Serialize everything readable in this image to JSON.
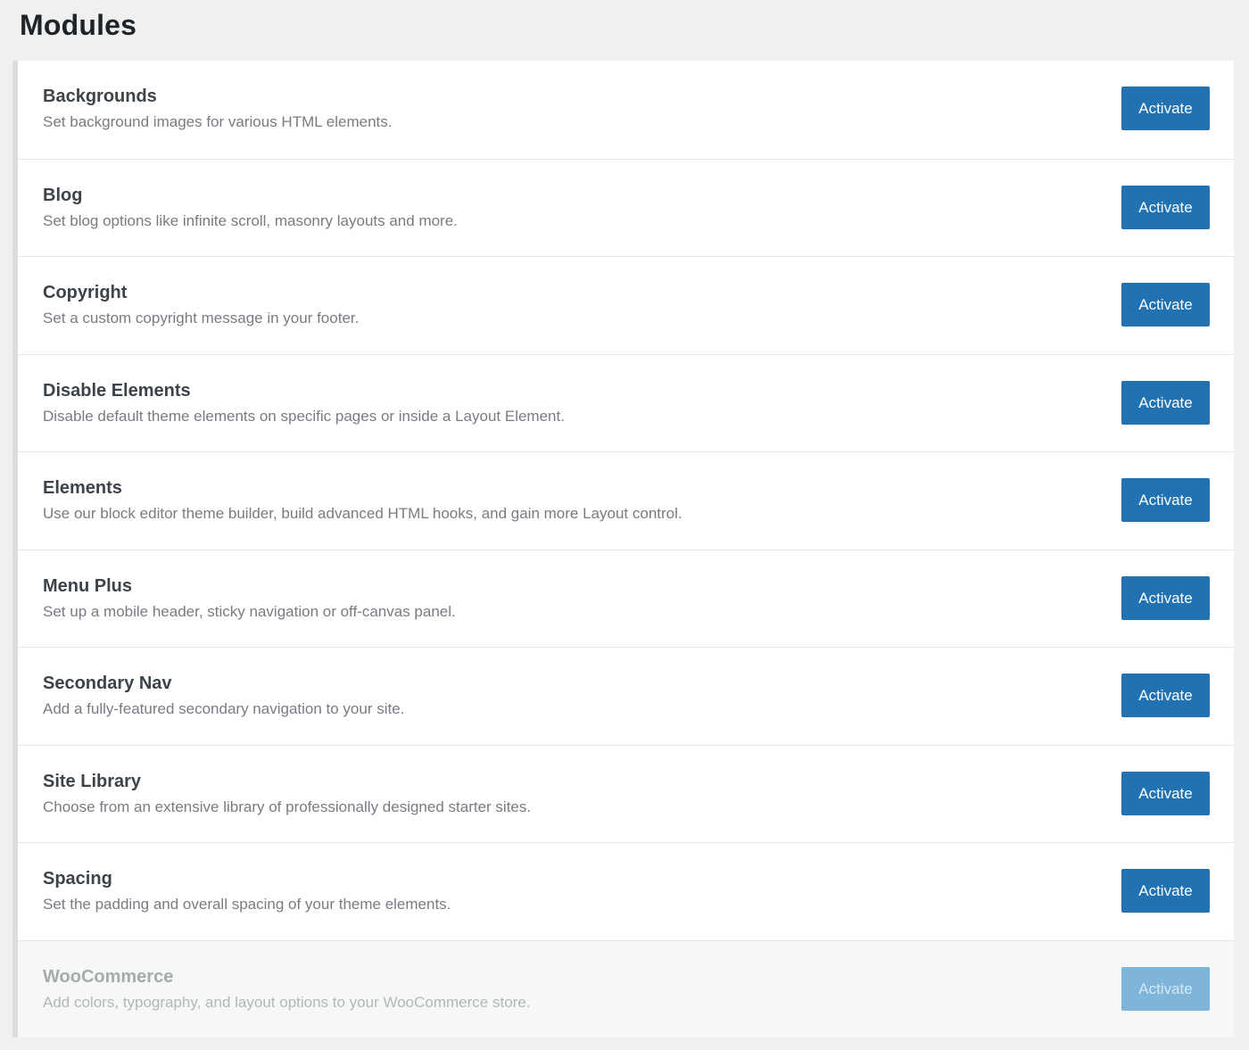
{
  "page": {
    "title": "Modules"
  },
  "colors": {
    "accent": "#2271b1",
    "accent_disabled": "#7fb5d9",
    "background": "#f0f0f1",
    "panel": "#ffffff",
    "panel_disabled": "#f6f7f7"
  },
  "modules": [
    {
      "title": "Backgrounds",
      "description": "Set background images for various HTML elements.",
      "button_label": "Activate",
      "disabled": false
    },
    {
      "title": "Blog",
      "description": "Set blog options like infinite scroll, masonry layouts and more.",
      "button_label": "Activate",
      "disabled": false
    },
    {
      "title": "Copyright",
      "description": "Set a custom copyright message in your footer.",
      "button_label": "Activate",
      "disabled": false
    },
    {
      "title": "Disable Elements",
      "description": "Disable default theme elements on specific pages or inside a Layout Element.",
      "button_label": "Activate",
      "disabled": false
    },
    {
      "title": "Elements",
      "description": "Use our block editor theme builder, build advanced HTML hooks, and gain more Layout control.",
      "button_label": "Activate",
      "disabled": false
    },
    {
      "title": "Menu Plus",
      "description": "Set up a mobile header, sticky navigation or off-canvas panel.",
      "button_label": "Activate",
      "disabled": false
    },
    {
      "title": "Secondary Nav",
      "description": "Add a fully-featured secondary navigation to your site.",
      "button_label": "Activate",
      "disabled": false
    },
    {
      "title": "Site Library",
      "description": "Choose from an extensive library of professionally designed starter sites.",
      "button_label": "Activate",
      "disabled": false
    },
    {
      "title": "Spacing",
      "description": "Set the padding and overall spacing of your theme elements.",
      "button_label": "Activate",
      "disabled": false
    },
    {
      "title": "WooCommerce",
      "description": "Add colors, typography, and layout options to your WooCommerce store.",
      "button_label": "Activate",
      "disabled": true
    }
  ]
}
